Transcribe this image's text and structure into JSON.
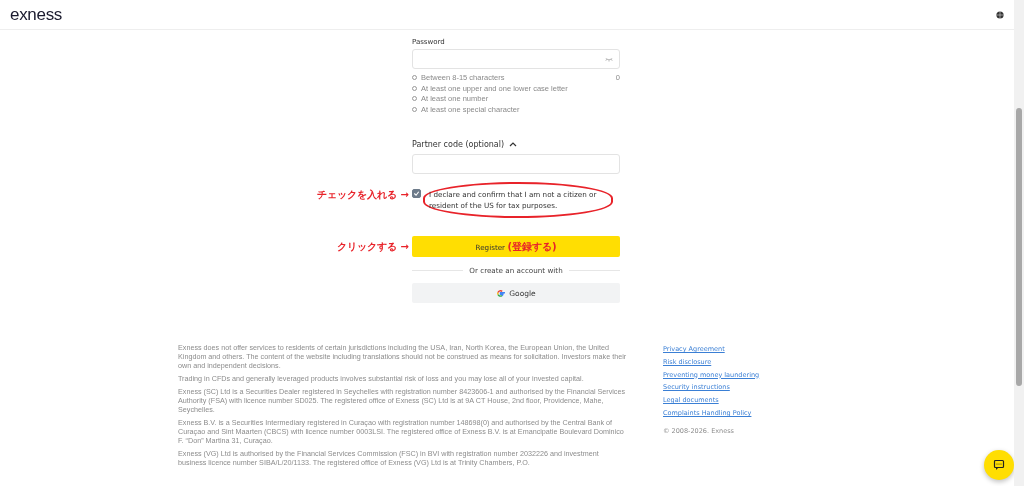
{
  "header": {
    "logo": "exness"
  },
  "password": {
    "label": "Password",
    "counter": "0",
    "rules": [
      {
        "text": "Between 8-15 characters",
        "met": false
      },
      {
        "text": "At least one upper and one lower case letter",
        "met": false
      },
      {
        "text": "At least one number",
        "met": false
      },
      {
        "text": "At least one special character",
        "met": false
      }
    ]
  },
  "partner_code": {
    "label": "Partner code (optional)",
    "expanded": true
  },
  "declaration": {
    "text": "I declare and confirm that I am not a citizen or resident of the US for tax purposes.",
    "checked": true,
    "annotation": "チェックを入れる →"
  },
  "register_button": {
    "label": "Register",
    "note": "(登録する)",
    "annotation": "クリックする →"
  },
  "divider_text": "Or create an account with",
  "google_button": {
    "label": "Google"
  },
  "footer": {
    "paragraphs": [
      "Exness does not offer services to residents of certain jurisdictions including the USA, Iran, North Korea, the European Union, the United Kingdom and others. The content of the website including translations should not be construed as means for solicitation. Investors make their own and independent decisions.",
      "Trading in CFDs and generally leveraged products involves substantial risk of loss and you may lose all of your invested capital.",
      "Exness (SC) Ltd is a Securities Dealer registered in Seychelles with registration number 8423606-1 and authorised by the Financial Services Authority (FSA) with licence number SD025. The registered office of Exness (SC) Ltd is at 9A CT House, 2nd floor, Providence, Mahe, Seychelles.",
      "Exness B.V. is a Securities Intermediary registered in Curaçao with registration number 148698(0) and authorised by the Central Bank of Curaçao and Sint Maarten (CBCS) with licence number 0003LSI. The registered office of Exness B.V. is at Emancipatie Boulevard Dominico F. “Don” Martina 31, Curaçao.",
      "Exness (VG) Ltd is authorised by the Financial Services Commission (FSC) in BVI with registration number 2032226 and investment business licence number SIBA/L/20/1133. The registered office of Exness (VG) Ltd is at Trinity Chambers, P.O."
    ],
    "links": [
      "Privacy Agreement",
      "Risk disclosure",
      "Preventing money laundering",
      "Security instructions",
      "Legal documents",
      "Complaints Handling Policy"
    ],
    "copyright": "© 2008-2026. Exness"
  }
}
